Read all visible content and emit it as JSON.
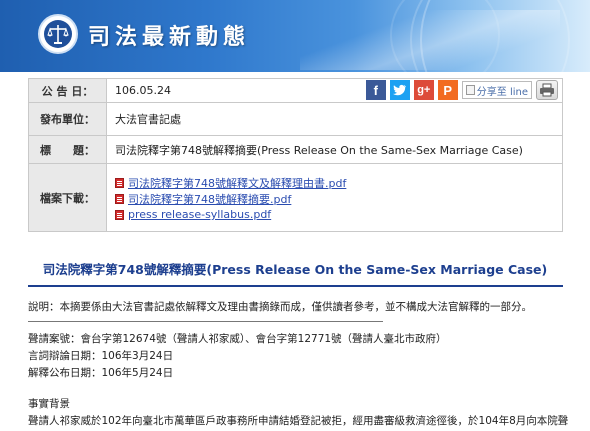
{
  "header": {
    "title": "司法最新動態"
  },
  "info_table": {
    "announce_label": "公 告 日：",
    "announce_date": "106.05.24",
    "unit_label": "發布單位：",
    "unit_value": "大法官書記處",
    "title_label": "標　　題：",
    "title_value": "司法院釋字第748號解釋摘要(Press Release On the Same-Sex Marriage Case)",
    "download_label": "檔案下載：",
    "files": [
      "司法院釋字第748號解釋文及解釋理由書.pdf",
      "司法院釋字第748號解釋摘要.pdf",
      "press release-syllabus.pdf"
    ]
  },
  "share": {
    "line_label": "分享至 line",
    "icons": [
      "facebook-icon",
      "twitter-icon",
      "google-plus-icon",
      "plurk-icon",
      "printer-icon"
    ]
  },
  "content": {
    "headline": "司法院釋字第748號解釋摘要(Press Release On the Same-Sex Marriage Case)",
    "note": "說明：本摘要係由大法官書記處依解釋文及理由書摘錄而成，僅供讀者參考，並不構成大法官解釋的一部分。",
    "case_line": "聲請案號：會台字第12674號（聲請人祁家威）、會台字第12771號（聲請人臺北市政府）",
    "debate_date": "言詞辯論日期：106年3月24日",
    "publish_date": "解釋公布日期：106年5月24日",
    "section_title": "事實背景",
    "section_text": "聲請人祁家威於102年向臺北市萬華區戶政事務所申請結婚登記被拒，經用盡審級救濟途徑後，於104年8月向本院聲"
  },
  "colors": {
    "headline": "#1d3f8f",
    "link": "#2a4cb0",
    "label_bg": "#e9e9e9"
  }
}
